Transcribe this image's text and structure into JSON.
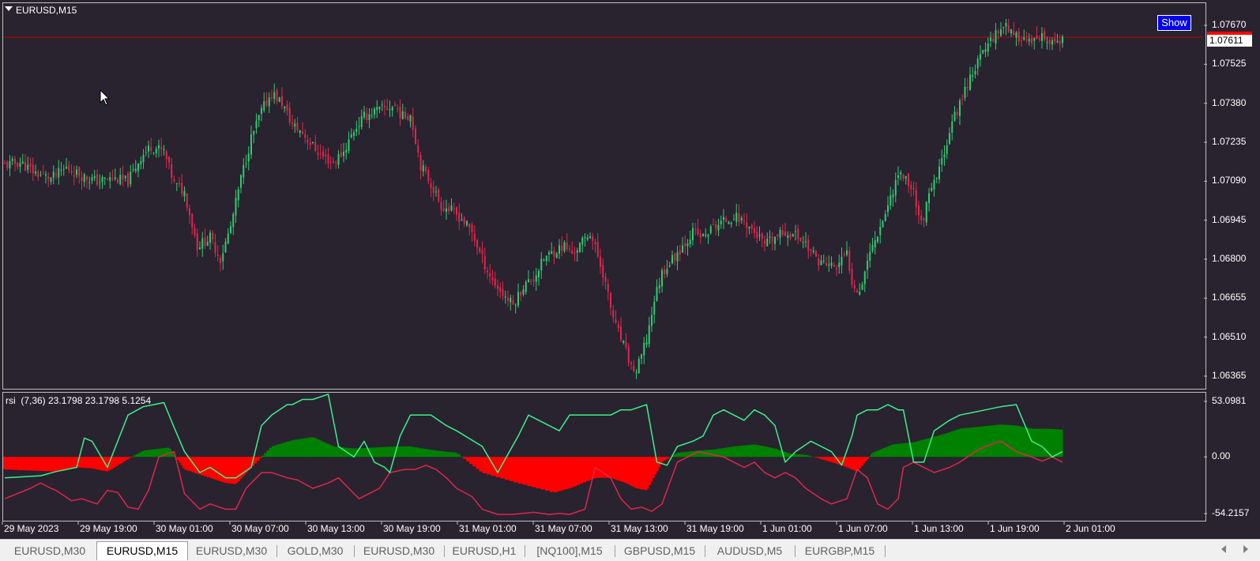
{
  "window": {
    "symbol_title": "EURUSD,M15",
    "show_button": "Show",
    "current_price": "1.07611"
  },
  "price_axis": [
    "1.07670",
    "1.07525",
    "1.07380",
    "1.07235",
    "1.07090",
    "1.06945",
    "1.06800",
    "1.06655",
    "1.06510",
    "1.06365"
  ],
  "indicator": {
    "title": "rsi  (7,36) 23.1798 23.1798 5.1254",
    "axis": [
      "53.0981",
      "0.00",
      "-54.2157"
    ]
  },
  "time_axis": [
    "29 May 2023",
    "29 May 19:00",
    "30 May 01:00",
    "30 May 07:00",
    "30 May 13:00",
    "30 May 19:00",
    "31 May 01:00",
    "31 May 07:00",
    "31 May 13:00",
    "31 May 19:00",
    "1 Jun 01:00",
    "1 Jun 07:00",
    "1 Jun 13:00",
    "1 Jun 19:00",
    "2 Jun 01:00"
  ],
  "tabs": [
    "EURUSD,M30",
    "EURUSD,M15",
    "EURUSD,M30",
    "GOLD,M30",
    "EURUSD,M30",
    "EURUSD,H1",
    "[NQ100],M15",
    "GBPUSD,M15",
    "AUDUSD,M5",
    "EURGBP,M15"
  ],
  "active_tab": 1,
  "colors": {
    "background": "#28232f",
    "bull_candle": "#2ecc71",
    "bear_candle": "#e0264b",
    "price_line": "#c00000",
    "rsi_positive_fill": "#008000",
    "rsi_negative_fill": "#ff0000",
    "rsi_fast_line": "#3cf08c",
    "rsi_slow_line": "#e0264b"
  },
  "icons": {
    "symbol_menu": "triangle-down-icon",
    "mouse_cursor": "arrow-cursor-icon",
    "tab_scroll_left": "triangle-left-icon",
    "tab_scroll_right": "triangle-right-icon"
  },
  "chart_data": [
    {
      "type": "candlestick",
      "title": "EURUSD,M15",
      "ylim": [
        1.0633,
        1.0768
      ],
      "current_price": 1.07611,
      "x_tick_labels": [
        "29 May 2023",
        "29 May 19:00",
        "30 May 01:00",
        "30 May 07:00",
        "30 May 13:00",
        "30 May 19:00",
        "31 May 01:00",
        "31 May 07:00",
        "31 May 13:00",
        "31 May 19:00",
        "1 Jun 01:00",
        "1 Jun 07:00",
        "1 Jun 13:00",
        "1 Jun 19:00",
        "2 Jun 01:00"
      ],
      "close_path": [
        [
          0,
          1.0715
        ],
        [
          6,
          1.0716
        ],
        [
          12,
          1.0712
        ],
        [
          18,
          1.071
        ],
        [
          24,
          1.0714
        ],
        [
          30,
          1.0711
        ],
        [
          36,
          1.0709
        ],
        [
          42,
          1.071
        ],
        [
          48,
          1.0709
        ],
        [
          53,
          1.0718
        ],
        [
          57,
          1.0722
        ],
        [
          62,
          1.072
        ],
        [
          66,
          1.0708
        ],
        [
          70,
          1.0705
        ],
        [
          75,
          1.0685
        ],
        [
          80,
          1.0688
        ],
        [
          84,
          1.068
        ],
        [
          88,
          1.0692
        ],
        [
          92,
          1.071
        ],
        [
          96,
          1.0725
        ],
        [
          100,
          1.0735
        ],
        [
          104,
          1.0742
        ],
        [
          108,
          1.0738
        ],
        [
          112,
          1.073
        ],
        [
          116,
          1.0727
        ],
        [
          120,
          1.0722
        ],
        [
          124,
          1.0718
        ],
        [
          128,
          1.0716
        ],
        [
          132,
          1.072
        ],
        [
          136,
          1.0728
        ],
        [
          140,
          1.0733
        ],
        [
          144,
          1.0735
        ],
        [
          148,
          1.0736
        ],
        [
          152,
          1.0737
        ],
        [
          155,
          1.0733
        ],
        [
          158,
          1.0734
        ],
        [
          162,
          1.0715
        ],
        [
          166,
          1.0708
        ],
        [
          170,
          1.07
        ],
        [
          174,
          1.0698
        ],
        [
          178,
          1.0695
        ],
        [
          182,
          1.069
        ],
        [
          186,
          1.068
        ],
        [
          190,
          1.0672
        ],
        [
          194,
          1.0667
        ],
        [
          198,
          1.0663
        ],
        [
          202,
          1.067
        ],
        [
          206,
          1.0673
        ],
        [
          210,
          1.068
        ],
        [
          214,
          1.0683
        ],
        [
          218,
          1.0685
        ],
        [
          221,
          1.0682
        ],
        [
          224,
          1.0685
        ],
        [
          228,
          1.069
        ],
        [
          230,
          1.0684
        ],
        [
          233,
          1.0675
        ],
        [
          236,
          1.0662
        ],
        [
          238,
          1.0655
        ],
        [
          241,
          1.0648
        ],
        [
          244,
          1.064
        ],
        [
          246,
          1.0638
        ],
        [
          250,
          1.065
        ],
        [
          253,
          1.0665
        ],
        [
          256,
          1.0675
        ],
        [
          260,
          1.068
        ],
        [
          264,
          1.0685
        ],
        [
          268,
          1.069
        ],
        [
          272,
          1.0688
        ],
        [
          276,
          1.0692
        ],
        [
          280,
          1.0694
        ],
        [
          284,
          1.0696
        ],
        [
          288,
          1.0694
        ],
        [
          292,
          1.069
        ],
        [
          296,
          1.0685
        ],
        [
          300,
          1.0688
        ],
        [
          304,
          1.069
        ],
        [
          308,
          1.0689
        ],
        [
          312,
          1.0686
        ],
        [
          316,
          1.068
        ],
        [
          320,
          1.0678
        ],
        [
          324,
          1.0677
        ],
        [
          328,
          1.0682
        ],
        [
          330,
          1.0672
        ],
        [
          333,
          1.0668
        ],
        [
          336,
          1.068
        ],
        [
          340,
          1.069
        ],
        [
          344,
          1.07
        ],
        [
          348,
          1.0712
        ],
        [
          351,
          1.071
        ],
        [
          354,
          1.0705
        ],
        [
          357,
          1.0693
        ],
        [
          360,
          1.0703
        ],
        [
          364,
          1.0713
        ],
        [
          368,
          1.0728
        ],
        [
          372,
          1.0738
        ],
        [
          376,
          1.0748
        ],
        [
          380,
          1.0755
        ],
        [
          384,
          1.0762
        ],
        [
          388,
          1.0766
        ],
        [
          390,
          1.0768
        ],
        [
          393,
          1.0762
        ],
        [
          396,
          1.0763
        ],
        [
          400,
          1.076
        ],
        [
          404,
          1.0762
        ],
        [
          408,
          1.076
        ],
        [
          412,
          1.0761
        ]
      ]
    },
    {
      "type": "area",
      "title": "rsi  (7,36) 23.1798 23.1798 5.1254",
      "ylim": [
        -54.2157,
        53.0981
      ],
      "y_tick_labels": [
        "53.0981",
        "0.00",
        "-54.2157"
      ],
      "series": [
        {
          "name": "rsi",
          "style": "filled histogram",
          "x": [
            0,
            20,
            28,
            34,
            40,
            48,
            54,
            64,
            70,
            80,
            86,
            90,
            96,
            104,
            112,
            120,
            128,
            136,
            152,
            158,
            168,
            176,
            186,
            200,
            214,
            220,
            230,
            236,
            242,
            246,
            250,
            256,
            262,
            270,
            276,
            284,
            292,
            300,
            306,
            312,
            318,
            326,
            332,
            338,
            346,
            354,
            360,
            366,
            372,
            380,
            388,
            394,
            400,
            406,
            412
          ],
          "values": [
            -12,
            -14,
            -10,
            -11,
            -14,
            -2,
            6,
            9,
            -12,
            -20,
            -25,
            -26,
            -10,
            10,
            16,
            19,
            10,
            8,
            10,
            10,
            6,
            4,
            -15,
            -25,
            -34,
            -30,
            -20,
            -20,
            -25,
            -30,
            -32,
            -5,
            4,
            6,
            7,
            10,
            12,
            8,
            3,
            2,
            -2,
            -8,
            -14,
            4,
            12,
            14,
            18,
            22,
            27,
            29,
            31,
            30,
            27,
            27,
            26
          ]
        },
        {
          "name": "fast",
          "style": "green line",
          "x": [
            0,
            14,
            20,
            28,
            31,
            34,
            40,
            48,
            54,
            58,
            62,
            66,
            70,
            76,
            80,
            86,
            90,
            96,
            100,
            104,
            110,
            112,
            116,
            120,
            126,
            130,
            136,
            140,
            144,
            148,
            150,
            154,
            158,
            166,
            172,
            176,
            186,
            192,
            200,
            204,
            208,
            216,
            220,
            230,
            236,
            240,
            244,
            250,
            254,
            258,
            262,
            268,
            272,
            276,
            280,
            284,
            288,
            292,
            296,
            300,
            304,
            308,
            314,
            318,
            322,
            326,
            330,
            332,
            336,
            340,
            344,
            348,
            350,
            354,
            358,
            362,
            368,
            372,
            378,
            382,
            388,
            394,
            400,
            404,
            408,
            412
          ],
          "values": [
            -20,
            -18,
            -14,
            -10,
            18,
            15,
            -10,
            40,
            48,
            50,
            52,
            28,
            5,
            -15,
            -10,
            -20,
            -20,
            -10,
            30,
            40,
            50,
            50,
            55,
            55,
            60,
            10,
            0,
            15,
            -5,
            -10,
            -15,
            20,
            40,
            40,
            30,
            25,
            10,
            -15,
            20,
            40,
            35,
            25,
            40,
            40,
            40,
            45,
            45,
            50,
            -5,
            -8,
            10,
            15,
            20,
            40,
            45,
            40,
            35,
            45,
            40,
            30,
            -5,
            5,
            15,
            10,
            5,
            -8,
            20,
            40,
            45,
            45,
            50,
            45,
            45,
            -5,
            -5,
            25,
            35,
            40,
            43,
            45,
            48,
            50,
            15,
            10,
            0,
            5
          ]
        },
        {
          "name": "slow",
          "style": "red line",
          "x": [
            0,
            10,
            14,
            18,
            20,
            26,
            30,
            36,
            40,
            44,
            48,
            52,
            56,
            60,
            66,
            70,
            76,
            80,
            86,
            90,
            94,
            98,
            100,
            104,
            110,
            114,
            120,
            126,
            130,
            134,
            138,
            142,
            146,
            150,
            156,
            160,
            164,
            168,
            172,
            176,
            182,
            186,
            192,
            198,
            206,
            212,
            216,
            220,
            226,
            230,
            236,
            240,
            244,
            248,
            252,
            256,
            262,
            266,
            270,
            276,
            280,
            284,
            288,
            292,
            296,
            300,
            304,
            308,
            312,
            318,
            322,
            328,
            332,
            336,
            340,
            344,
            348,
            350,
            354,
            358,
            362,
            368,
            372,
            378,
            382,
            388,
            394,
            400,
            404,
            408,
            412
          ],
          "values": [
            -40,
            -30,
            -25,
            -30,
            -32,
            -42,
            -40,
            -45,
            -32,
            -34,
            -48,
            -50,
            -32,
            0,
            5,
            -35,
            -50,
            -45,
            -50,
            -50,
            -30,
            -20,
            -15,
            -15,
            -20,
            -22,
            -30,
            -25,
            -20,
            -30,
            -40,
            -35,
            -30,
            -15,
            -12,
            -12,
            -8,
            -12,
            -20,
            -30,
            -38,
            -50,
            -55,
            -55,
            -53,
            -55,
            -54,
            -55,
            -50,
            -10,
            -20,
            -40,
            -50,
            -48,
            -52,
            -45,
            -5,
            0,
            5,
            2,
            0,
            -5,
            -10,
            -5,
            -15,
            -20,
            -15,
            -20,
            -30,
            -40,
            -45,
            -40,
            -12,
            -20,
            -45,
            -50,
            -40,
            -10,
            -5,
            -10,
            -15,
            -10,
            -5,
            5,
            10,
            15,
            5,
            0,
            -4,
            0,
            -5
          ]
        }
      ]
    }
  ]
}
